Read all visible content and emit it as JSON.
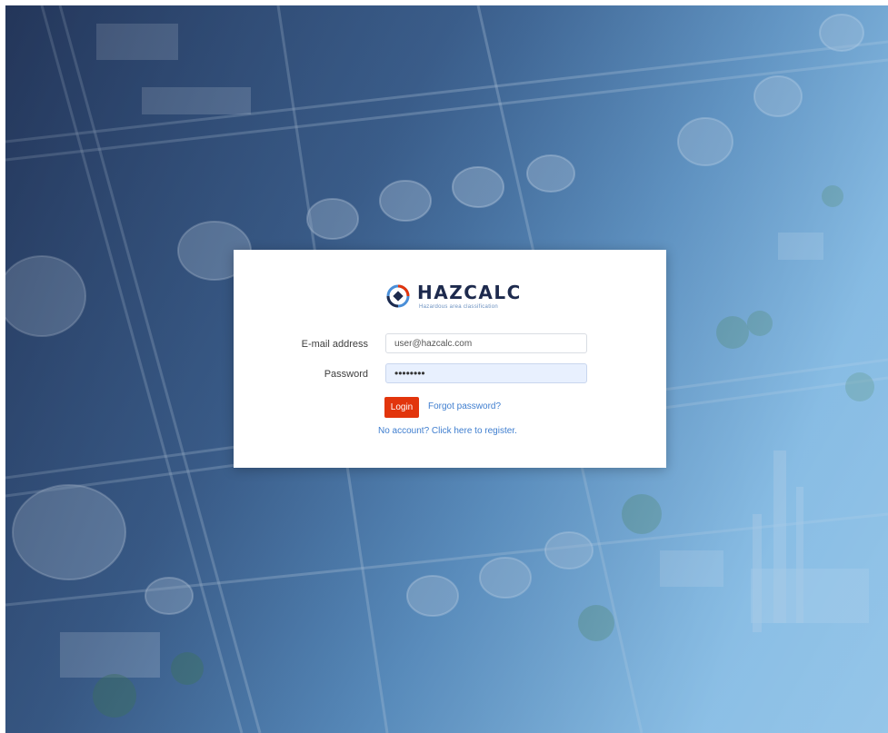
{
  "brand": {
    "name": "HAZCALC",
    "tagline": "Hazardous area classification"
  },
  "form": {
    "email_label": "E-mail address",
    "email_value": "user@hazcalc.com",
    "password_label": "Password",
    "password_value": "••••••••",
    "login_label": "Login",
    "forgot_label": "Forgot password?",
    "register_label": "No account? Click here to register."
  },
  "colors": {
    "accent": "#e2350c",
    "link": "#3f7ecf",
    "brand_dark": "#1d2a4d",
    "brand_blue": "#4a8fd8"
  },
  "icons": {
    "logo": "hazcalc-logo-icon"
  }
}
